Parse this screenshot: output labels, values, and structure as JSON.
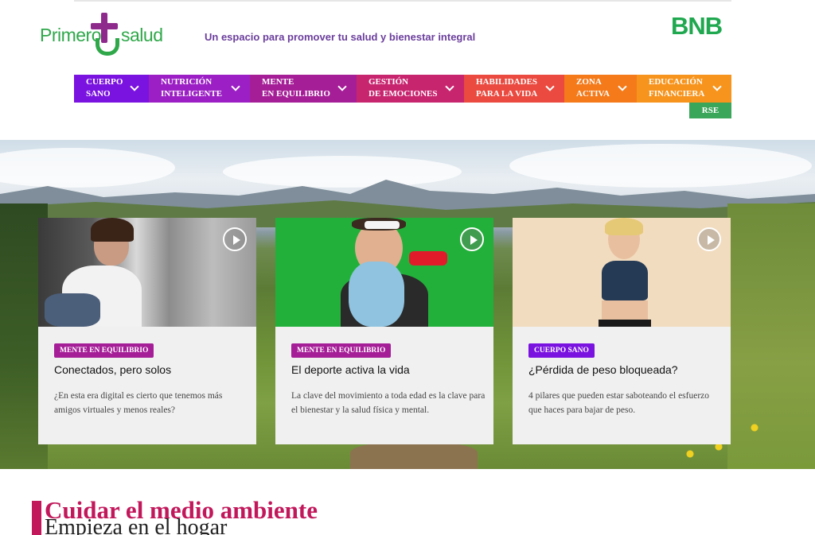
{
  "header": {
    "logo_word1": "Primero",
    "logo_word2": "salud",
    "tagline": "Un espacio para promover tu salud y bienestar integral",
    "brand": "BNB"
  },
  "nav": {
    "items": [
      {
        "label": "CUERPO\nSANO",
        "color": "#7a12e0"
      },
      {
        "label": "NUTRICIÓN\nINTELIGENTE",
        "color": "#9b1fc4"
      },
      {
        "label": "MENTE\nEN EQUILIBRIO",
        "color": "#a51d97"
      },
      {
        "label": "GESTIÓN\nDE EMOCIONES",
        "color": "#c8256f"
      },
      {
        "label": "HABILIDADES\nPARA LA VIDA",
        "color": "#ea4a3f"
      },
      {
        "label": "ZONA\nACTIVA",
        "color": "#f47a1a"
      },
      {
        "label": "EDUCACIÓN\nFINANCIERA",
        "color": "#f7941d"
      }
    ],
    "rse_label": "RSE"
  },
  "cards": [
    {
      "tag": "MENTE EN EQUILIBRIO",
      "tag_color": "#a51d97",
      "title": "Conectados, pero solos",
      "desc": "¿En esta era digital es cierto que tenemos más amigos virtuales y menos reales?"
    },
    {
      "tag": "MENTE EN EQUILIBRIO",
      "tag_color": "#a51d97",
      "title": "El deporte activa la vida",
      "desc": "La clave del movimiento a toda edad es la clave para el bienestar y la salud física y mental."
    },
    {
      "tag": "CUERPO SANO",
      "tag_color": "#7a12e0",
      "title": "¿Pérdida de peso bloqueada?",
      "desc": "4 pilares que pueden estar saboteando el esfuerzo que haces para bajar de peso."
    }
  ],
  "section": {
    "title": "Cuidar el medio ambiente",
    "subtitle": "Empieza en el hogar"
  }
}
